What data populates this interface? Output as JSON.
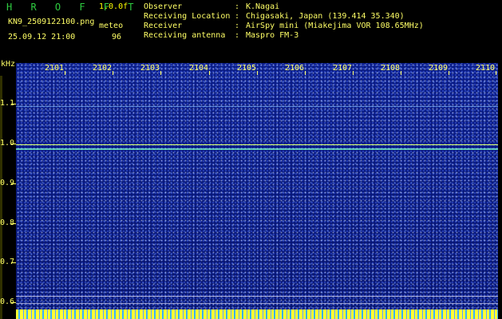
{
  "header": {
    "brand": "H R O F F T",
    "version": "1.0.0f",
    "filename": "KN9_2509122100.png",
    "datetime": "25.09.12 21:00",
    "meteo_label": "meteo",
    "meteo_value": "96"
  },
  "info": [
    {
      "key": "Observer",
      "value": "K.Nagai"
    },
    {
      "key": "Receiving Location",
      "value": "Chigasaki, Japan (139.414 35.340)"
    },
    {
      "key": "Receiver",
      "value": "AirSpy mini (Miakejima VOR 108.65MHz)"
    },
    {
      "key": "Receiving antenna",
      "value": "Maspro FM-3"
    }
  ],
  "axis": {
    "unit": "kHz",
    "y_labels": [
      "1.1",
      "1.0",
      "0.9",
      "0.8",
      "0.7",
      "0.6"
    ],
    "x_labels": [
      "2101",
      "2102",
      "2103",
      "2104",
      "2105",
      "2106",
      "2107",
      "2108",
      "2109",
      "2110"
    ]
  },
  "colors": {
    "text": "#ffff66",
    "title": "#2ecc40",
    "background": "#0a1c85",
    "signal": "#c8ff64"
  }
}
